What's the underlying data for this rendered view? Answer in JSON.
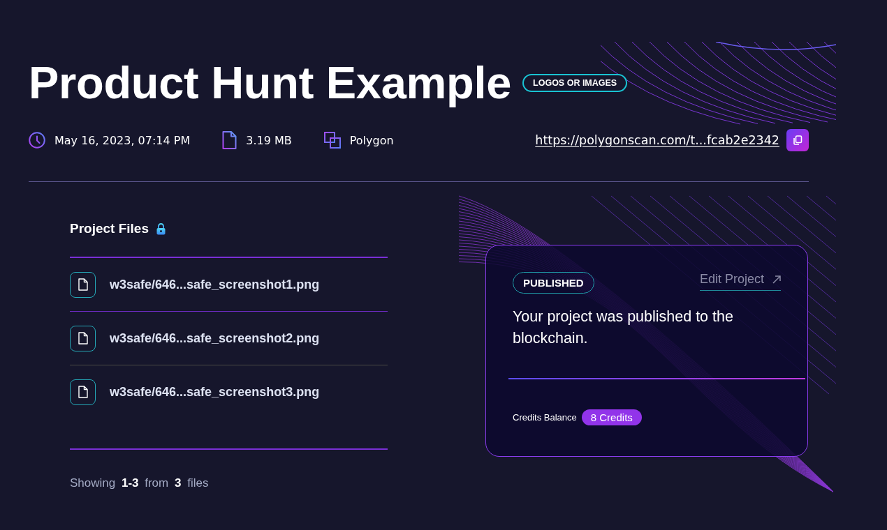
{
  "header": {
    "title": "Product Hunt Example",
    "category_tag": "LOGOS OR IMAGES"
  },
  "meta": [
    {
      "kind": "date",
      "text": "May 16, 2023, 07:14 PM"
    },
    {
      "kind": "size",
      "text": "3.19 MB"
    },
    {
      "kind": "network",
      "text": "Polygon"
    }
  ],
  "transaction_link": {
    "text": "https://polygonscan.com/t...fcab2e2342"
  },
  "files_panel": {
    "title": "Project Files",
    "files": [
      "w3safe/646...safe_screenshot1.png",
      "w3safe/646...safe_screenshot2.png",
      "w3safe/646...safe_screenshot3.png"
    ],
    "footer": "Showing **1-3** from **3** files"
  },
  "status_card": {
    "status": "PUBLISHED",
    "edit_link": "Edit Project",
    "message": "Your project was published to the blockchain.",
    "credits_label": "Credits Balance",
    "credits": "8 Credits"
  }
}
